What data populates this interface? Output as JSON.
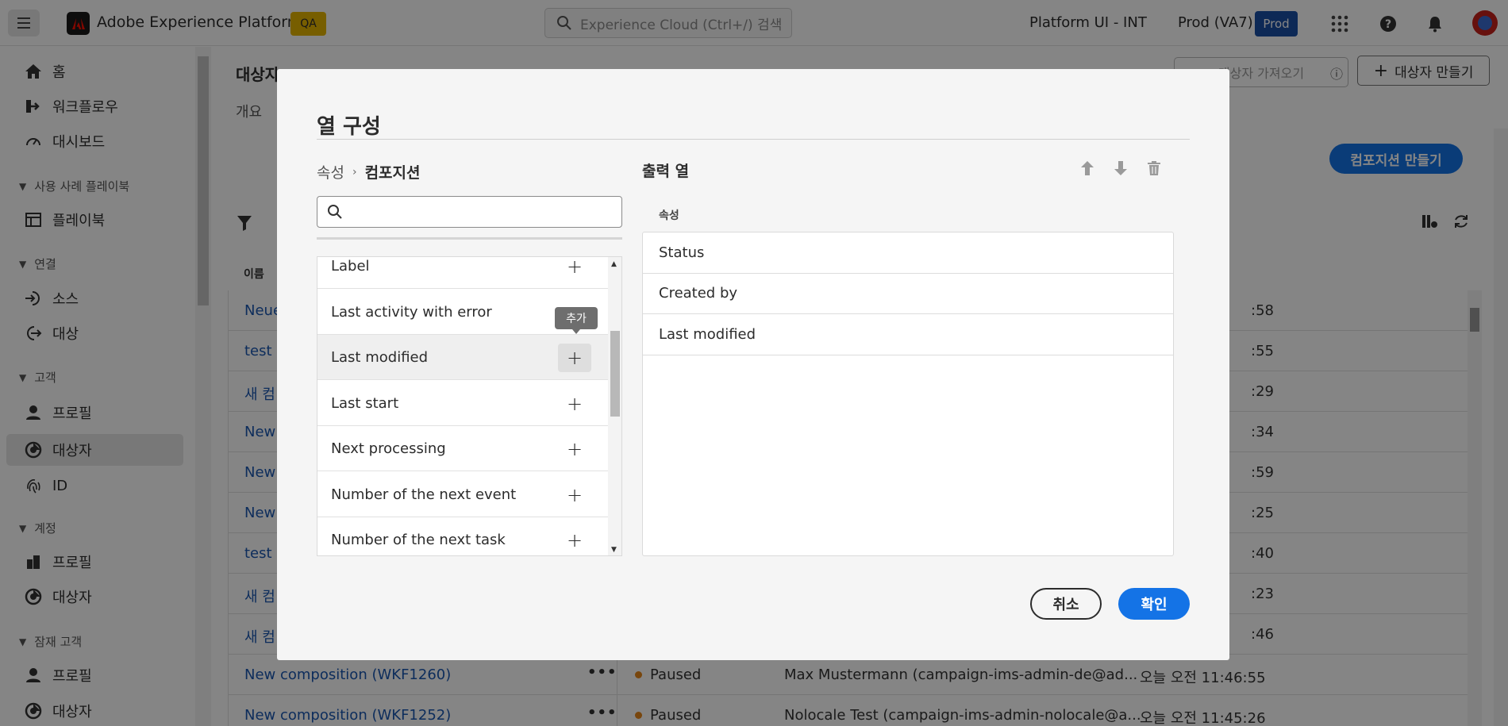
{
  "topbar": {
    "app_title": "Adobe Experience Platform",
    "env_badge": "QA",
    "search_placeholder": "Experience Cloud (Ctrl+/) 검색",
    "org_name": "Platform UI - INT",
    "sandbox_name": "Prod (VA7)",
    "sandbox_badge": "Prod"
  },
  "nav": {
    "home": "홈",
    "workflow": "워크플로우",
    "dashboard": "대시보드",
    "sec_playbooks": "사용 사례 플레이북",
    "playbooks": "플레이북",
    "sec_connections": "연결",
    "sources": "소스",
    "destinations": "대상",
    "sec_customer": "고객",
    "profiles": "프로필",
    "audiences": "대상자",
    "identities": "ID",
    "sec_account": "계정",
    "account_profiles": "프로필",
    "account_audiences": "대상자",
    "sec_prospect": "잠재 고객",
    "prospect_profiles": "프로필",
    "prospect_audiences": "대상자"
  },
  "background": {
    "page_title": "대상자",
    "tab_overview": "개요",
    "import_button": "대상자 가져오기",
    "create_audience_button": "대상자 만들기",
    "create_composition_button": "컴포지션 만들기",
    "name_column": "이름",
    "rows": [
      {
        "name": "Neue",
        "status": "",
        "by": "",
        "time": ":58"
      },
      {
        "name": "test (",
        "status": "",
        "by": "",
        "time": ":55"
      },
      {
        "name": "새 컴",
        "status": "",
        "by": "",
        "time": ":29"
      },
      {
        "name": "New",
        "status": "",
        "by": "",
        "time": ":34"
      },
      {
        "name": "New",
        "status": "",
        "by": "",
        "time": ":59"
      },
      {
        "name": "New",
        "status": "",
        "by": "",
        "time": ":25"
      },
      {
        "name": "test (",
        "status": "",
        "by": "",
        "time": ":40"
      },
      {
        "name": "새 컴",
        "status": "",
        "by": "",
        "time": ":23"
      },
      {
        "name": "새 컴",
        "status": "",
        "by": "",
        "time": ":46"
      },
      {
        "name": "New composition (WKF1260)",
        "status": "Paused",
        "by": "Max Mustermann (campaign-ims-admin-de@ad...",
        "time": "오늘 오전 11:46:55"
      },
      {
        "name": "New composition (WKF1252)",
        "status": "Paused",
        "by": "Nolocale Test (campaign-ims-admin-nolocale@a...",
        "time": "오늘 오전 11:45:26"
      }
    ]
  },
  "modal": {
    "title": "열 구성",
    "breadcrumb_root": "속성",
    "breadcrumb_current": "컴포지션",
    "search_value": "",
    "attributes": [
      "Label",
      "Last activity with error",
      "Last modified",
      "Last start",
      "Next processing",
      "Number of the next event",
      "Number of the next task"
    ],
    "hovered_attribute": "Last modified",
    "tooltip": "추가",
    "output_title": "출력 열",
    "output_col_header": "속성",
    "output_columns": [
      "Status",
      "Created by",
      "Last modified"
    ],
    "cancel_label": "취소",
    "ok_label": "확인"
  },
  "colors": {
    "accent": "#1473e6",
    "status_paused": "#e68619",
    "qa_badge": "#e5b400",
    "prod_badge": "#1a4fa6"
  }
}
